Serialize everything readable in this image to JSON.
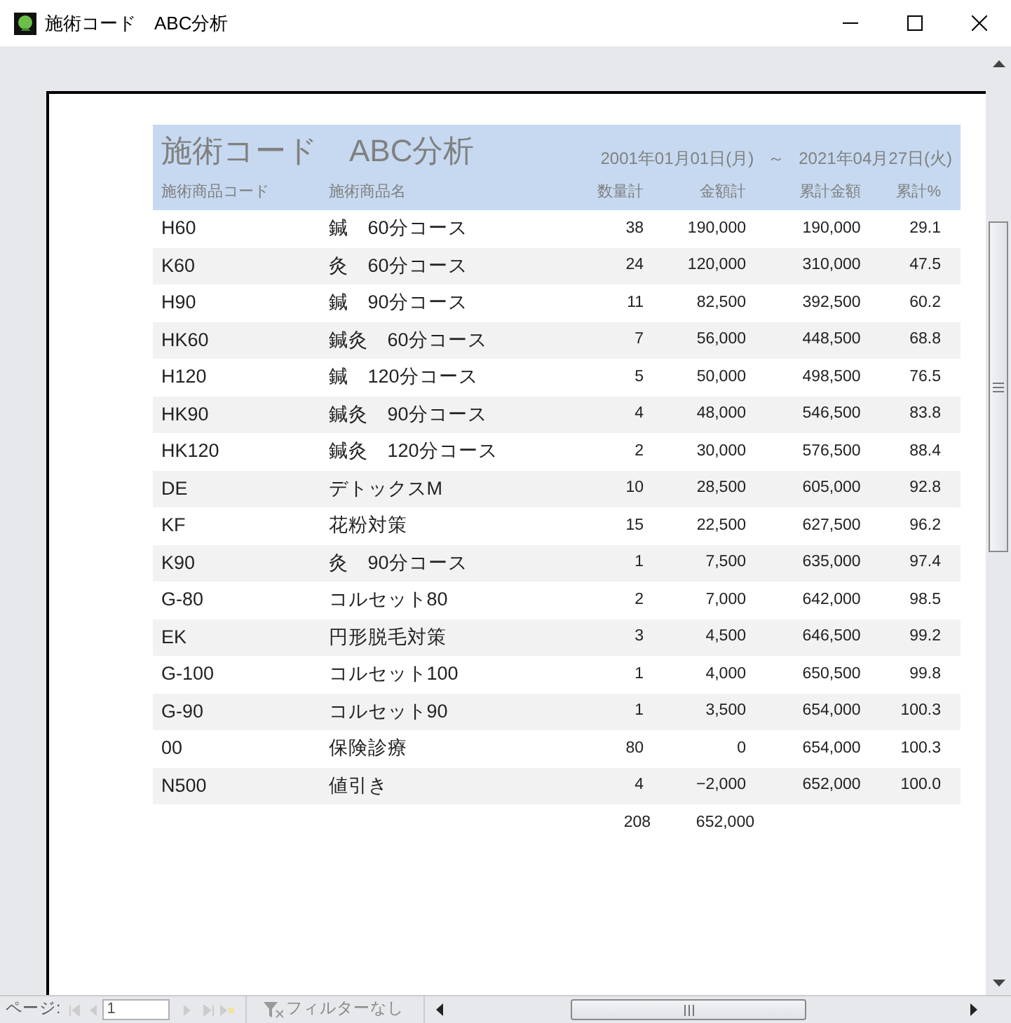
{
  "window": {
    "title": "施術コード　ABC分析"
  },
  "report": {
    "title": "施術コード　ABC分析",
    "date_from": "2001年01月01日(月)",
    "date_separator": "～",
    "date_to": "2021年04月27日(火)",
    "columns": [
      "施術商品コード",
      "施術商品名",
      "数量計",
      "金額計",
      "累計金額",
      "累計%"
    ],
    "rows": [
      [
        "H60",
        "鍼　60分コース",
        "38",
        "190,000",
        "190,000",
        "29.1"
      ],
      [
        "K60",
        "灸　60分コース",
        "24",
        "120,000",
        "310,000",
        "47.5"
      ],
      [
        "H90",
        "鍼　90分コース",
        "11",
        "82,500",
        "392,500",
        "60.2"
      ],
      [
        "HK60",
        "鍼灸　60分コース",
        "7",
        "56,000",
        "448,500",
        "68.8"
      ],
      [
        "H120",
        "鍼　120分コース",
        "5",
        "50,000",
        "498,500",
        "76.5"
      ],
      [
        "HK90",
        "鍼灸　90分コース",
        "4",
        "48,000",
        "546,500",
        "83.8"
      ],
      [
        "HK120",
        "鍼灸　120分コース",
        "2",
        "30,000",
        "576,500",
        "88.4"
      ],
      [
        "DE",
        "デトックスM",
        "10",
        "28,500",
        "605,000",
        "92.8"
      ],
      [
        "KF",
        "花粉対策",
        "15",
        "22,500",
        "627,500",
        "96.2"
      ],
      [
        "K90",
        "灸　90分コース",
        "1",
        "7,500",
        "635,000",
        "97.4"
      ],
      [
        "G-80",
        "コルセット80",
        "2",
        "7,000",
        "642,000",
        "98.5"
      ],
      [
        "EK",
        "円形脱毛対策",
        "3",
        "4,500",
        "646,500",
        "99.2"
      ],
      [
        "G-100",
        "コルセット100",
        "1",
        "4,000",
        "650,500",
        "99.8"
      ],
      [
        "G-90",
        "コルセット90",
        "1",
        "3,500",
        "654,000",
        "100.3"
      ],
      [
        "00",
        "保険診療",
        "80",
        "0",
        "654,000",
        "100.3"
      ],
      [
        "N500",
        "値引き",
        "4",
        "−2,000",
        "652,000",
        "100.0"
      ]
    ],
    "totals": {
      "quantity": "208",
      "amount": "652,000"
    }
  },
  "navigation": {
    "page_label": "ページ:",
    "page": "1",
    "filter": "フィルターなし"
  }
}
